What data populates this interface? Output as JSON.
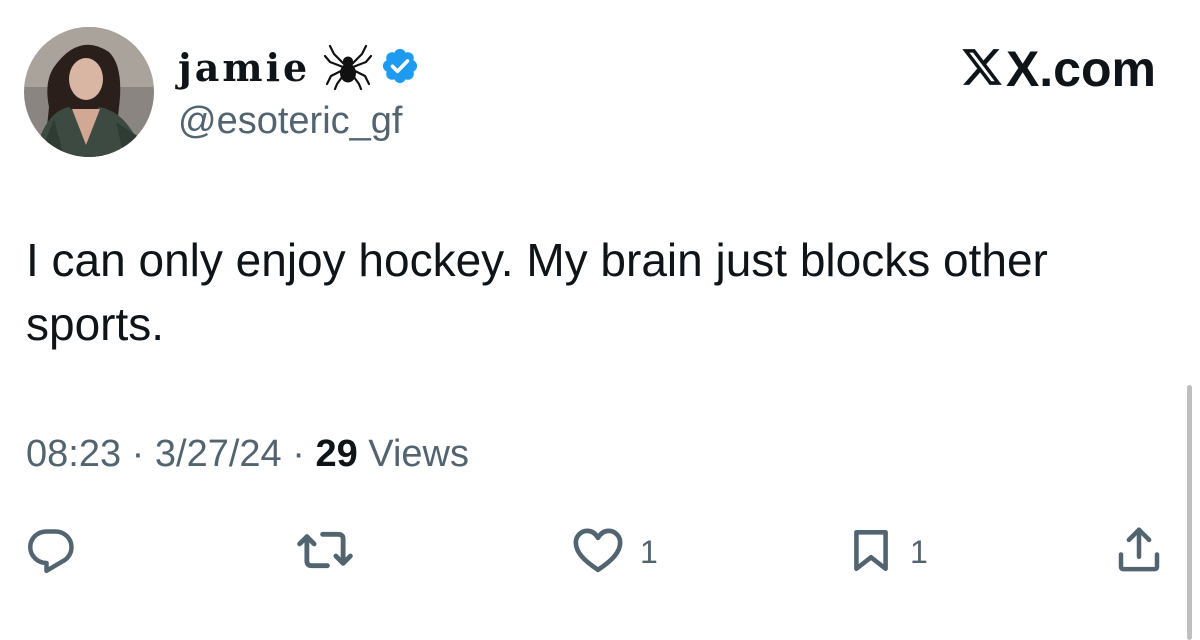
{
  "author": {
    "display_name": "jamie",
    "handle": "@esoteric_gf",
    "name_emoji": "spider-icon",
    "verified_badge_color": "#1d9bf0"
  },
  "brand": {
    "label": "X.com"
  },
  "tweet": {
    "text": "I can only enjoy hockey. My brain just blocks other sports."
  },
  "meta": {
    "time": "08:23",
    "separator_1": "·",
    "date": "3/27/24",
    "separator_2": "·",
    "views_count": "29",
    "views_label": "Views"
  },
  "actions": {
    "reply": {
      "icon": "reply-icon",
      "count": ""
    },
    "repost": {
      "icon": "repost-icon",
      "count": ""
    },
    "like": {
      "icon": "heart-icon",
      "count": "1"
    },
    "bookmark": {
      "icon": "bookmark-icon",
      "count": "1"
    },
    "share": {
      "icon": "share-icon",
      "count": ""
    }
  },
  "colors": {
    "text_primary": "#0f1419",
    "text_secondary": "#536471",
    "accent": "#1d9bf0"
  }
}
